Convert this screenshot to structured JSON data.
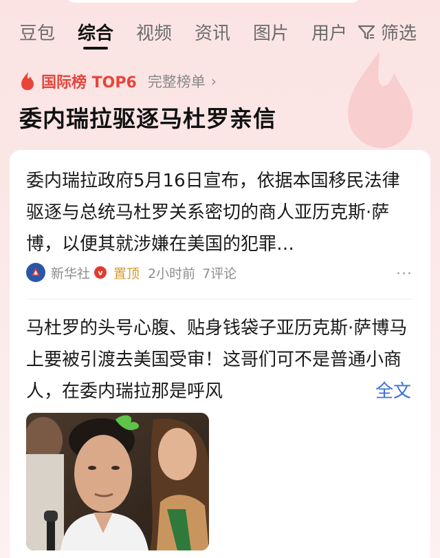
{
  "tabs": [
    {
      "label": "豆包"
    },
    {
      "label": "综合"
    },
    {
      "label": "视频"
    },
    {
      "label": "资讯"
    },
    {
      "label": "图片"
    },
    {
      "label": "用户"
    }
  ],
  "active_tab": "综合",
  "filter_label": "筛选",
  "hot_list": {
    "title": "国际榜 TOP6",
    "full_list_label": "完整榜单",
    "headline": "委内瑞拉驱逐马杜罗亲信"
  },
  "article": {
    "text": "委内瑞拉政府5月16日宣布，依据本国移民法律驱逐与总统马杜罗关系密切的商人亚历克斯·萨博，以便其就涉嫌在美国的犯罪…",
    "source": "新华社",
    "verified_badge": "v",
    "pinned_label": "置顶",
    "time": "2小时前",
    "comments": "7评论",
    "more_label": "···"
  },
  "post": {
    "text": "马杜罗的头号心腹、贴身钱袋子亚历克斯·萨博马上要被引渡去美国受审！这哥们可不是普通小商人，在委内瑞拉那是呼风",
    "full_text_label": "全文"
  },
  "colors": {
    "accent_red": "#e8443a",
    "link_blue": "#3a6fd8",
    "pinned_gold": "#d39a2c"
  }
}
